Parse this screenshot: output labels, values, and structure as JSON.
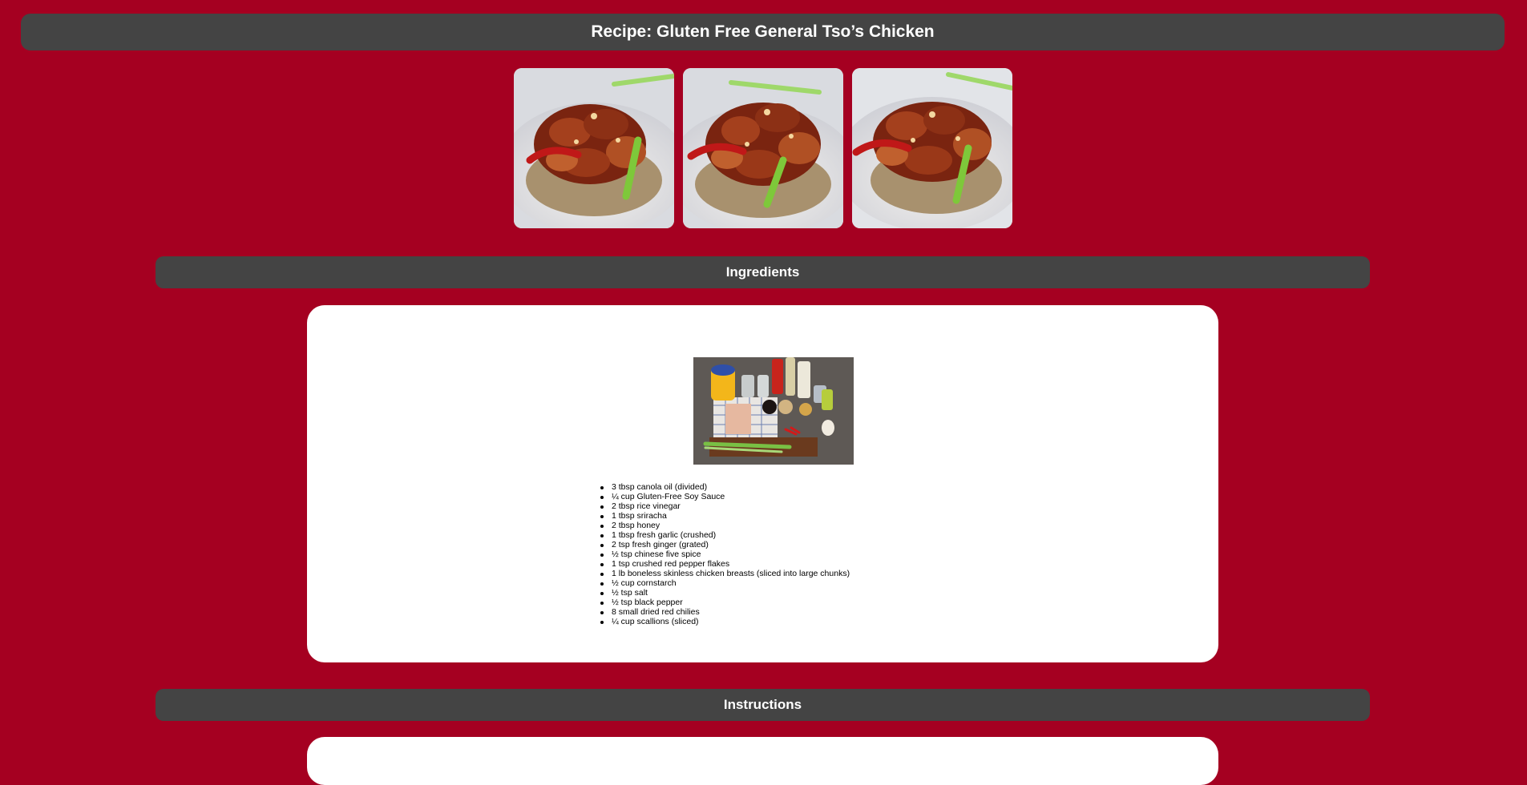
{
  "page": {
    "title": "Recipe: Gluten Free General Tso’s Chicken",
    "background_color": "#a50021",
    "bar_color": "#444444"
  },
  "gallery": {
    "images": [
      {
        "name": "general-tso-chicken-photo-1"
      },
      {
        "name": "general-tso-chicken-photo-2"
      },
      {
        "name": "general-tso-chicken-photo-3"
      }
    ]
  },
  "ingredients": {
    "heading": "Ingredients",
    "image_name": "ingredients-photo",
    "items": [
      "3 tbsp canola oil (divided)",
      "¼ cup Gluten-Free Soy Sauce",
      "2 tbsp rice vinegar",
      "1 tbsp sriracha",
      "2 tbsp honey",
      "1 tbsp fresh garlic (crushed)",
      "2 tsp fresh ginger (grated)",
      "½ tsp chinese five spice",
      "1 tsp crushed red pepper flakes",
      "1 lb boneless skinless chicken breasts (sliced into large chunks)",
      "½ cup cornstarch",
      "½ tsp salt",
      "½ tsp black pepper",
      "8 small dried red chilies",
      "¼ cup scallions (sliced)"
    ]
  },
  "instructions": {
    "heading": "Instructions"
  }
}
